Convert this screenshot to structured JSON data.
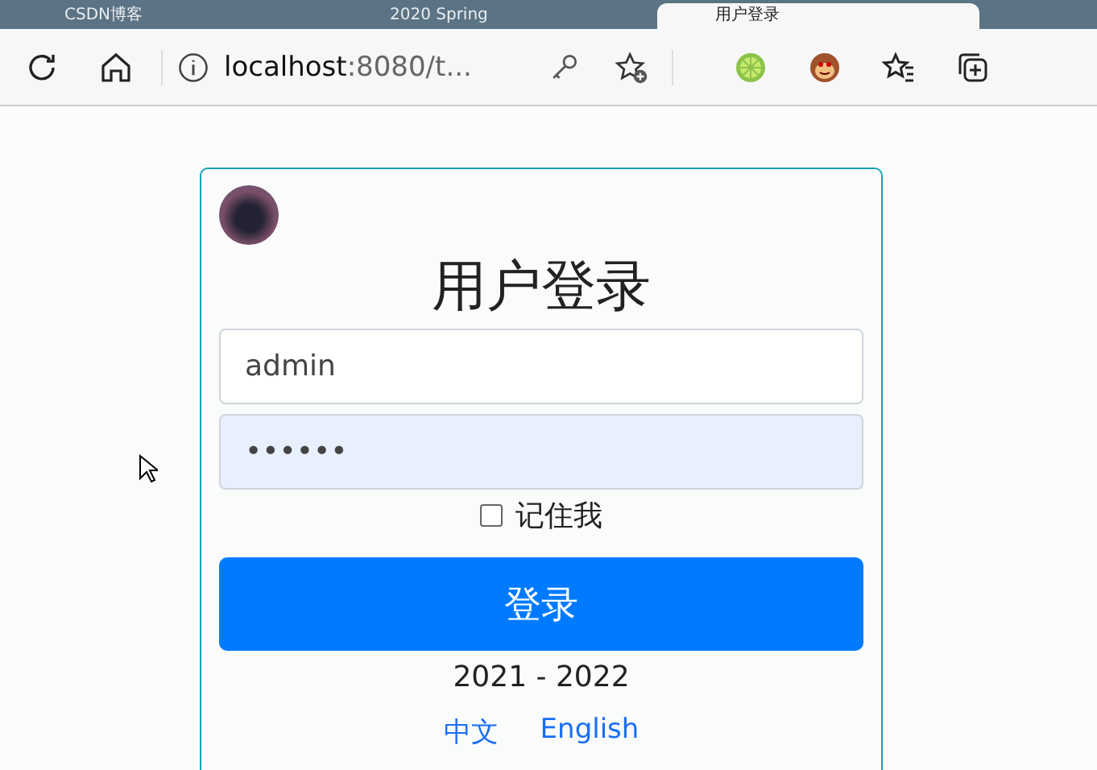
{
  "browser": {
    "tabs": [
      {
        "title": "CSDN博客",
        "selected": false
      },
      {
        "title": "2020 Spring",
        "selected": false
      },
      {
        "title": "用户登录",
        "selected": true
      }
    ],
    "address": {
      "host": "localhost",
      "rest": ":8080/t..."
    }
  },
  "login": {
    "title": "用户登录",
    "username": "admin",
    "password": "••••••",
    "remember": {
      "label": "记住我",
      "checked": false
    },
    "submit": "登录",
    "footer": "2021 - 2022",
    "languages": [
      {
        "label": "中文"
      },
      {
        "label": "English"
      }
    ]
  }
}
